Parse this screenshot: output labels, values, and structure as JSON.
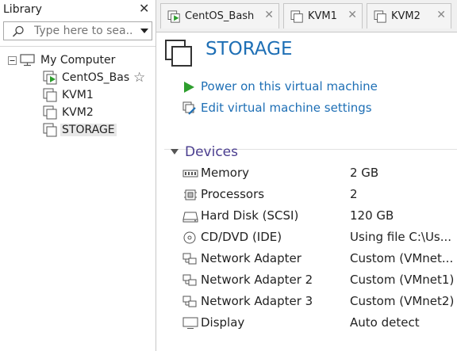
{
  "library": {
    "title": "Library",
    "search_placeholder": "Type here to sea...",
    "tree": {
      "root": "My Computer",
      "items": [
        "CentOS_Bas",
        "KVM1",
        "KVM2",
        "STORAGE"
      ]
    }
  },
  "tabs": [
    {
      "label": "CentOS_Bash"
    },
    {
      "label": "KVM1"
    },
    {
      "label": "KVM2"
    }
  ],
  "main": {
    "title": "STORAGE",
    "actions": [
      "Power on this virtual machine",
      "Edit virtual machine settings"
    ],
    "devices_label": "Devices",
    "devices": [
      {
        "name": "Memory",
        "value": "2 GB",
        "icon": "memory-icon"
      },
      {
        "name": "Processors",
        "value": "2",
        "icon": "processor-icon"
      },
      {
        "name": "Hard Disk (SCSI)",
        "value": "120 GB",
        "icon": "hard-disk-icon"
      },
      {
        "name": "CD/DVD (IDE)",
        "value": "Using file C:\\Us...",
        "icon": "cd-dvd-icon"
      },
      {
        "name": "Network Adapter",
        "value": "Custom (VMnet...",
        "icon": "network-adapter-icon"
      },
      {
        "name": "Network Adapter 2",
        "value": "Custom (VMnet1)",
        "icon": "network-adapter-icon"
      },
      {
        "name": "Network Adapter 3",
        "value": "Custom (VMnet2)",
        "icon": "network-adapter-icon"
      },
      {
        "name": "Display",
        "value": "Auto detect",
        "icon": "display-icon"
      }
    ]
  },
  "colors": {
    "link": "#1e6fb5",
    "section": "#4a3d8f",
    "play": "#2e9e2e"
  }
}
